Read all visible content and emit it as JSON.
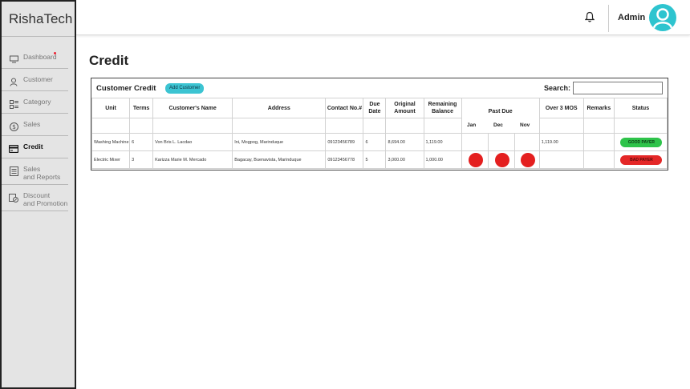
{
  "app": {
    "brand": "RishaTech"
  },
  "sidebar": {
    "items": [
      {
        "label": "Dashboard",
        "icon": "monitor-icon",
        "active": false
      },
      {
        "label": "Customer",
        "icon": "user-icon",
        "active": false
      },
      {
        "label": "Category",
        "icon": "category-icon",
        "active": false
      },
      {
        "label": "Sales",
        "icon": "dollar-icon",
        "active": false
      },
      {
        "label": "Credit",
        "icon": "credit-card-icon",
        "active": true
      },
      {
        "label": "Sales\nand Reports",
        "icon": "report-icon",
        "active": false
      },
      {
        "label": "Discount\nand Promotion",
        "icon": "discount-icon",
        "active": false
      }
    ]
  },
  "topbar": {
    "user": "Admin",
    "bell_icon": "bell-icon",
    "avatar_icon": "user-avatar-icon",
    "avatar_color": "#2ec4cf"
  },
  "main": {
    "title": "Credit",
    "card": {
      "title": "Customer Credit",
      "add_label": "Add Customer",
      "search_label": "Search:",
      "search_value": ""
    },
    "table": {
      "headers": {
        "unit": "Unit",
        "terms": "Terms",
        "name": "Customer's Name",
        "address": "Address",
        "contact": "Contact No.#",
        "due": "Due Date",
        "original": "Original Amount",
        "remaining": "Remaining Balance",
        "past_due": "Past Due",
        "over3": "Over 3 MOS",
        "remarks": "Remarks",
        "status": "Status",
        "jan": "Jan",
        "dec": "Dec",
        "nov": "Nov"
      },
      "rows": [
        {
          "unit": "Washing Machine",
          "terms": "6",
          "name": "Von Bris L. Lacdao",
          "address": "Ini, Mogpog, Marinduque",
          "contact": "09123456789",
          "due": "6",
          "original": "8,694.00",
          "remaining": "1,119.00",
          "past_due": [
            false,
            false,
            false
          ],
          "over3": "1,119.00",
          "remarks": "",
          "status": "GOOD PAYER",
          "status_type": "good"
        },
        {
          "unit": "Electric Mixer",
          "terms": "3",
          "name": "Karizza Marie M. Mercado",
          "address": "Bagacay, Buenavista, Marinduque",
          "contact": "09123456778",
          "due": "5",
          "original": "3,000.00",
          "remaining": "1,000.00",
          "past_due": [
            true,
            true,
            true
          ],
          "over3": "",
          "remarks": "",
          "status": "BAD PAYER",
          "status_type": "bad"
        }
      ]
    }
  },
  "colors": {
    "accent": "#3cc4d2",
    "good": "#2ec34a",
    "bad": "#e42727",
    "past_due_dot": "#e41f1f"
  }
}
